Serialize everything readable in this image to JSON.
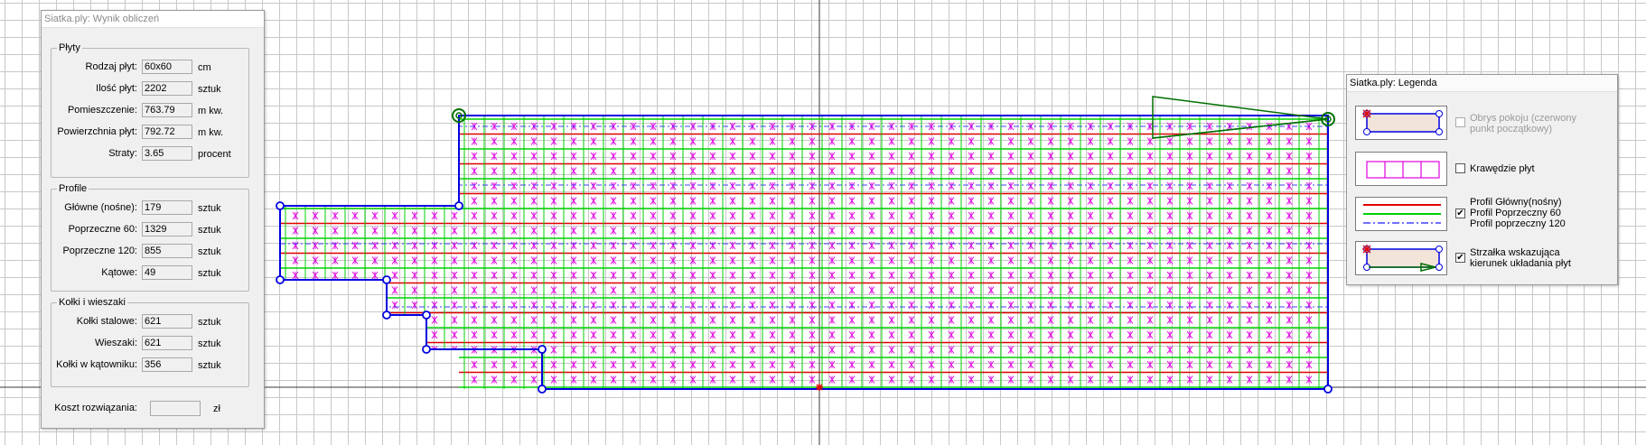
{
  "results_panel": {
    "title": "Siatka.ply: Wynik obliczeń",
    "plyty": {
      "legend": "Płyty",
      "rows": [
        {
          "label": "Rodzaj płyt:",
          "value": "60x60",
          "unit": "cm"
        },
        {
          "label": "Ilość płyt:",
          "value": "2202",
          "unit": "sztuk"
        },
        {
          "label": "Pomieszczenie:",
          "value": "763.79",
          "unit": "m kw."
        },
        {
          "label": "Powierzchnia płyt:",
          "value": "792.72",
          "unit": "m kw."
        },
        {
          "label": "Straty:",
          "value": "3.65",
          "unit": "procent"
        }
      ]
    },
    "profile": {
      "legend": "Profile",
      "rows": [
        {
          "label": "Główne (nośne):",
          "value": "179",
          "unit": "sztuk"
        },
        {
          "label": "Poprzeczne 60:",
          "value": "1329",
          "unit": "sztuk"
        },
        {
          "label": "Poprzeczne 120:",
          "value": "855",
          "unit": "sztuk"
        },
        {
          "label": "Kątowe:",
          "value": "49",
          "unit": "sztuk"
        }
      ]
    },
    "kolki": {
      "legend": "Kołki i wieszaki",
      "rows": [
        {
          "label": "Kołki stalowe:",
          "value": "621",
          "unit": "sztuk"
        },
        {
          "label": "Wieszaki:",
          "value": "621",
          "unit": "sztuk"
        },
        {
          "label": "Kołki w kątowniku:",
          "value": "356",
          "unit": "sztuk"
        }
      ]
    },
    "cost": {
      "label": "Koszt rozwiązania:",
      "value": "",
      "unit": "zł"
    }
  },
  "legend_panel": {
    "title": "Siatka.ply: Legenda",
    "items": [
      {
        "lines": [
          "Obrys pokoju (czerwony",
          "punkt początkowy)"
        ],
        "checked": false,
        "disabled": true
      },
      {
        "lines": [
          "Krawędzie płyt"
        ],
        "checked": false,
        "disabled": false
      },
      {
        "lines": [
          "Profil Główny(nośny)",
          "Profil Poprzeczny 60",
          "Profil poprzeczny 120"
        ],
        "checked": true,
        "disabled": false
      },
      {
        "lines": [
          "Strzałka wskazująca",
          "kierunek układania płyt"
        ],
        "checked": true,
        "disabled": false
      }
    ]
  },
  "colors": {
    "room_outline": "#0000e0",
    "main_profile": "#e00000",
    "cross_profile_60": "#00d000",
    "cross_profile_120": "#4040ff",
    "tile_edges": "#e000e0",
    "arrow": "#007000",
    "check_mark": "✔"
  }
}
